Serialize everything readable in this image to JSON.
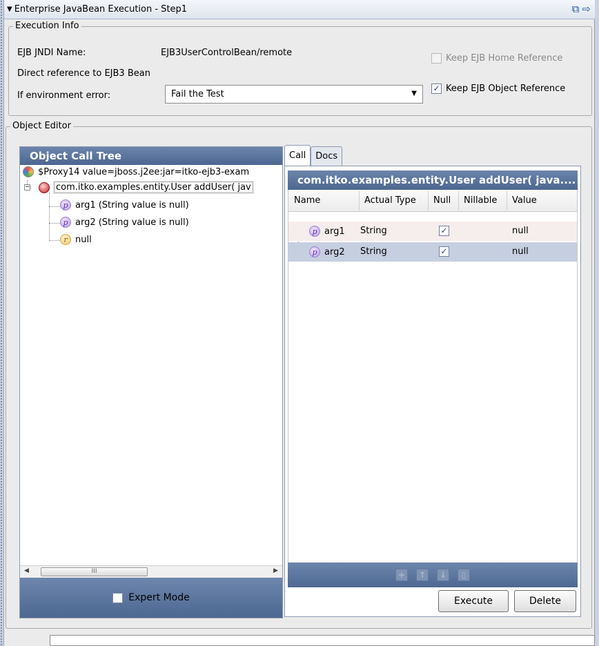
{
  "title_bar": {
    "title": "Enterprise JavaBean Execution - Step1",
    "icons": [
      "popout-icon",
      "arrow-right-icon"
    ]
  },
  "execution_info": {
    "legend": "Execution Info",
    "jndi_label": "EJB JNDI Name:",
    "jndi_value": "EJB3UserControlBean/remote",
    "direct_ref": "Direct reference to EJB3 Bean",
    "env_error_label": "If environment error:",
    "env_error_value": "Fail the Test",
    "keep_home": {
      "label": "Keep EJB Home Reference",
      "checked": false,
      "enabled": false
    },
    "keep_object": {
      "label": "Keep EJB Object Reference",
      "checked": true,
      "enabled": true
    }
  },
  "object_editor": {
    "legend": "Object Editor",
    "tree": {
      "header": "Object Call Tree",
      "nodes": [
        {
          "icon": "proxy-icon",
          "text": "$Proxy14 value=jboss.j2ee:jar=itko-ejb3-exam"
        },
        {
          "icon": "method-icon",
          "text": "com.itko.examples.entity.User addUser( jav"
        },
        {
          "icon": "p",
          "text": "arg1 (String value is null)"
        },
        {
          "icon": "p",
          "text": "arg2 (String value is null)"
        },
        {
          "icon": "r",
          "text": "null"
        }
      ],
      "scroll_thumb": "III",
      "expert_mode": {
        "label": "Expert Mode",
        "checked": false
      }
    },
    "tabs": [
      "Call",
      "Docs"
    ],
    "active_tab": "Call",
    "call": {
      "header": "com.itko.examples.entity.User addUser( java....",
      "columns": [
        "Name",
        "Actual Type",
        "Null",
        "Nillable",
        "Value"
      ],
      "rows": [
        {
          "name": "arg1",
          "type": "String",
          "null": true,
          "nillable": "",
          "value": "null"
        },
        {
          "name": "arg2",
          "type": "String",
          "null": true,
          "nillable": "",
          "value": "null"
        }
      ],
      "tools": [
        "+",
        "↑",
        "↓",
        "▯"
      ]
    },
    "buttons": {
      "execute": "Execute",
      "delete": "Delete"
    }
  },
  "colors": {
    "header_blue": "#5a7399",
    "row_selected": "#c6cfe0",
    "row_alt": "#f6eded"
  }
}
